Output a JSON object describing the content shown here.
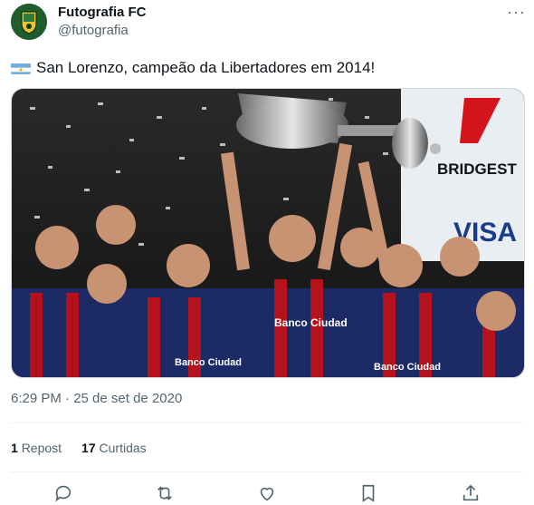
{
  "account": {
    "display_name": "Futografia FC",
    "handle": "@futografia"
  },
  "tweet": {
    "text": "San Lorenzo, campeão da Libertadores em 2014!",
    "timestamp": "6:29 PM · 25 de set de 2020",
    "flag_icon": "argentina-flag-icon"
  },
  "media": {
    "banner_brand": "BRIDGEST",
    "banner_brand2": "VISA",
    "shirt_sponsor": "Banco Ciudad"
  },
  "stats": {
    "reposts_count": "1",
    "reposts_label": "Repost",
    "likes_count": "17",
    "likes_label": "Curtidas"
  },
  "colors": {
    "text_primary": "#0f1419",
    "text_secondary": "#536471",
    "divider": "#eff3f4"
  }
}
